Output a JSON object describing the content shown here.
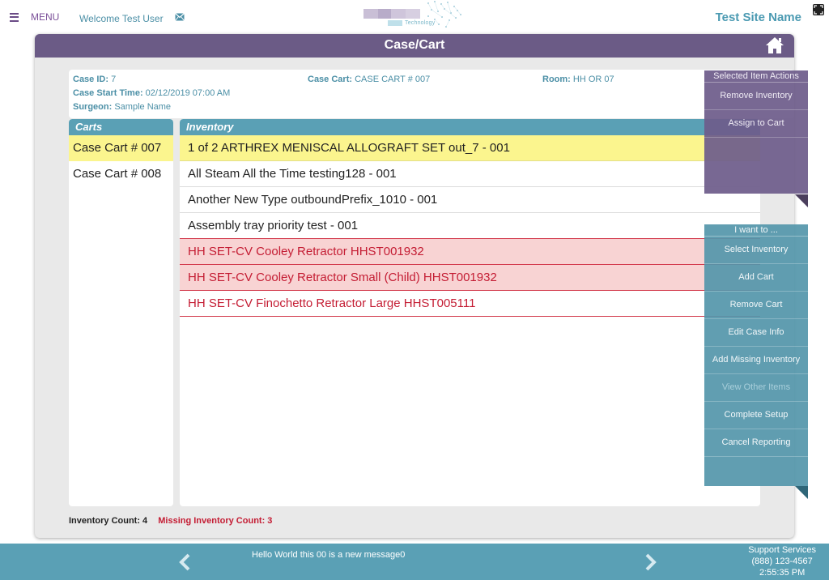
{
  "header": {
    "menu_label": "MENU",
    "welcome": "Welcome Test User",
    "logo_text": "Technology",
    "site_name": "Test Site Name"
  },
  "panel": {
    "title": "Case/Cart"
  },
  "case_info": {
    "case_id_label": "Case ID:",
    "case_id": "7",
    "start_label": "Case Start Time:",
    "start_time": "02/12/2019 07:00 AM",
    "surgeon_label": "Surgeon:",
    "surgeon": "Sample Name",
    "cart_label": "Case Cart:",
    "cart": "CASE CART # 007",
    "room_label": "Room:",
    "room": "HH OR 07"
  },
  "carts": {
    "heading": "Carts",
    "items": [
      "Case Cart # 007",
      "Case Cart # 008"
    ]
  },
  "inventory": {
    "heading": "Inventory",
    "rows": [
      "1 of 2 ARTHREX MENISCAL ALLOGRAFT SET out_7 - 001",
      "All Steam All the Time testing128 - 001",
      "Another New Type outboundPrefix_1010 - 001",
      "Assembly tray priority test - 001",
      "HH SET-CV Cooley Retractor HHST001932",
      "HH SET-CV Cooley Retractor Small (Child) HHST001932",
      "HH SET-CV Finochetto Retractor Large HHST005111"
    ]
  },
  "counts": {
    "inventory": "Inventory Count: 4",
    "missing": "Missing Inventory Count: 3"
  },
  "selected_actions": {
    "heading": "Selected Item Actions",
    "items": [
      "Remove Inventory",
      "Assign to Cart"
    ]
  },
  "want_actions": {
    "heading": "I want to ...",
    "items": [
      "Select Inventory",
      "Add Cart",
      "Remove Cart",
      "Edit Case Info",
      "Add Missing Inventory",
      "View Other Items",
      "Complete Setup",
      "Cancel Reporting"
    ]
  },
  "footer": {
    "message": "Hello World this 00 is a new message0",
    "support_title": "Support Services",
    "support_phone": "(888) 123-4567",
    "time": "2:55:35 PM"
  },
  "colors": {
    "purple": "#6b5b86",
    "teal": "#5aa0b5",
    "selected_yellow": "#fbf58e",
    "missing_red": "#c41c33",
    "missing_bg": "#f8d3d3"
  },
  "icons": [
    "menu-icon",
    "mail-icon",
    "expand-icon",
    "home-icon",
    "chevron-left-icon",
    "chevron-right-icon"
  ]
}
